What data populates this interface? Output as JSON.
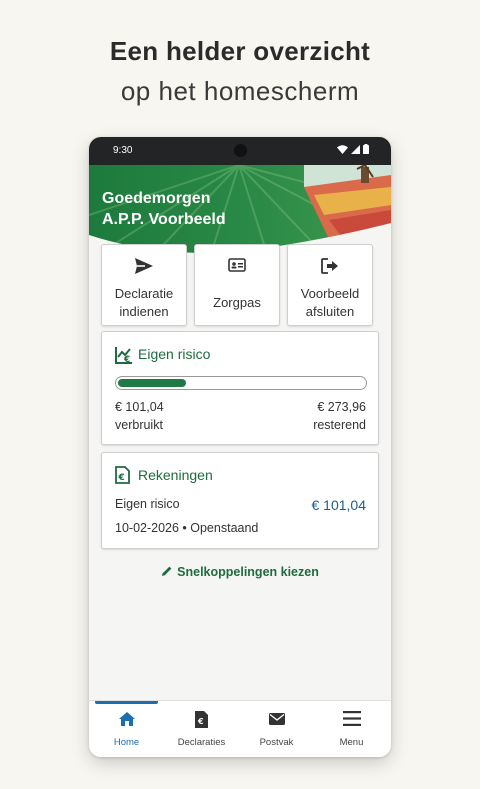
{
  "promo": {
    "line1": "Een helder overzicht",
    "line2": "op het homescherm"
  },
  "statusbar": {
    "time": "9:30"
  },
  "greeting": {
    "line1": "Goedemorgen",
    "line2": "A.P.P. Voorbeeld"
  },
  "tiles": [
    {
      "label_1": "Declaratie",
      "label_2": "indienen",
      "icon": "send-icon"
    },
    {
      "label": "Zorgpas",
      "icon": "id-card-icon"
    },
    {
      "label_1": "Voorbeeld",
      "label_2": "afsluiten",
      "icon": "sign-out-icon"
    }
  ],
  "eigen_risico": {
    "title": "Eigen risico",
    "progress_fraction": 0.27,
    "used_amount": "€ 101,04",
    "used_label": "verbruikt",
    "remaining_amount": "€ 273,96",
    "remaining_label": "resterend"
  },
  "rekeningen": {
    "title": "Rekeningen",
    "item_name": "Eigen risico",
    "item_amount": "€ 101,04",
    "item_meta": "10-02-2026 • Openstaand"
  },
  "shortcut": {
    "label": "Snelkoppelingen kiezen"
  },
  "nav": [
    {
      "label": "Home",
      "icon": "home-icon",
      "active": true
    },
    {
      "label": "Declaraties",
      "icon": "euro-document-icon",
      "active": false
    },
    {
      "label": "Postvak",
      "icon": "mail-icon",
      "active": false
    },
    {
      "label": "Menu",
      "icon": "hamburger-menu-icon",
      "active": false
    }
  ],
  "colors": {
    "brand_green": "#1f6b3f",
    "progress_green": "#1f7a46",
    "amount_blue": "#1a5f8c",
    "nav_active_blue": "#1a6fb0"
  }
}
